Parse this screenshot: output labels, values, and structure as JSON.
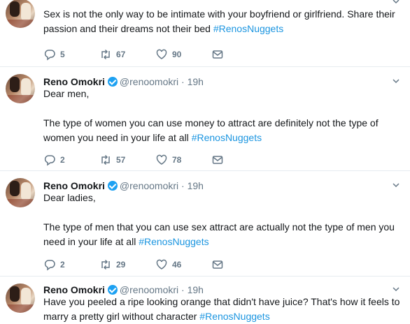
{
  "tweets": [
    {
      "name": "",
      "handle": "",
      "time": "",
      "paragraphs": [
        "Sex is not the only way to be intimate with your boyfriend or girlfriend. Share their passion and their dreams not their bed"
      ],
      "hashtag": "#RenosNuggets",
      "replies": "5",
      "retweets": "67",
      "likes": "90"
    },
    {
      "name": "Reno Omokri",
      "handle": "@renoomokri",
      "time": "19h",
      "paragraphs": [
        "Dear men,",
        "The type of women you can use money to attract are definitely not the type of women you need in your life at all"
      ],
      "hashtag": "#RenosNuggets",
      "replies": "2",
      "retweets": "57",
      "likes": "78"
    },
    {
      "name": "Reno Omokri",
      "handle": "@renoomokri",
      "time": "19h",
      "paragraphs": [
        "Dear ladies,",
        "The type of men that you can use sex attract are actually not the type of men you need in your life at all"
      ],
      "hashtag": "#RenosNuggets",
      "replies": "2",
      "retweets": "29",
      "likes": "46"
    },
    {
      "name": "Reno Omokri",
      "handle": "@renoomokri",
      "time": "19h",
      "paragraphs": [
        "Have you  peeled a ripe looking orange that didn't have juice? That's how it feels to marry a pretty girl without character"
      ],
      "hashtag": "#RenosNuggets"
    }
  ],
  "separator": "·",
  "colors": {
    "link": "#1b95e0",
    "verified": "#1da1f2",
    "muted": "#657786"
  },
  "icons": [
    "reply-icon",
    "retweet-icon",
    "like-icon",
    "dm-icon",
    "chevron-down-icon",
    "verified-badge-icon"
  ]
}
